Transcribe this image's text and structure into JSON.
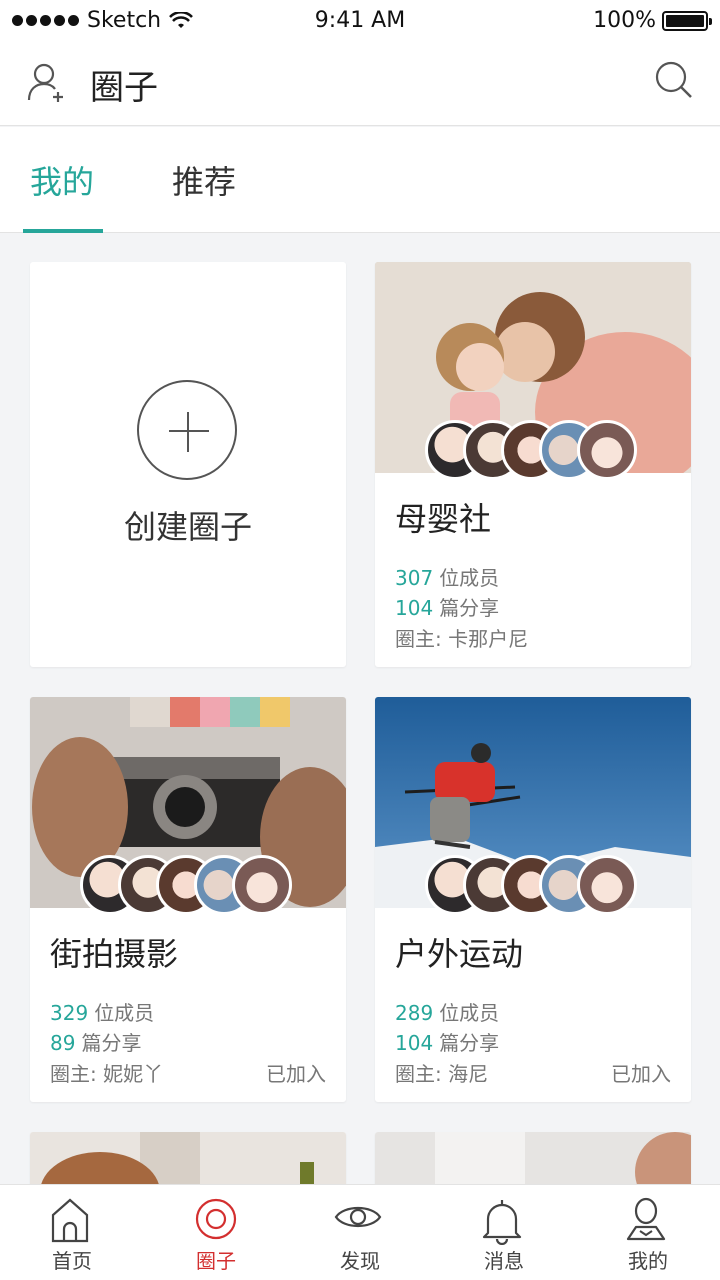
{
  "status_bar": {
    "carrier": "Sketch",
    "time": "9:41 AM",
    "battery": "100%"
  },
  "header": {
    "title": "圈子"
  },
  "tabs": [
    {
      "label": "我的",
      "active": true
    },
    {
      "label": "推荐",
      "active": false
    }
  ],
  "create_card": {
    "label": "创建圈子"
  },
  "circles": [
    {
      "title": "母婴社",
      "members": "307",
      "members_label": "位成员",
      "shares": "104",
      "shares_label": "篇分享",
      "owner": "圈主: 卡那户尼",
      "joined": ""
    },
    {
      "title": "街拍摄影",
      "members": "329",
      "members_label": "位成员",
      "shares": "89",
      "shares_label": "篇分享",
      "owner": "圈主: 妮妮丫",
      "joined": "已加入"
    },
    {
      "title": "户外运动",
      "members": "289",
      "members_label": "位成员",
      "shares": "104",
      "shares_label": "篇分享",
      "owner": "圈主: 海尼",
      "joined": "已加入"
    }
  ],
  "nav": [
    {
      "label": "首页",
      "icon": "home-icon",
      "active": false
    },
    {
      "label": "圈子",
      "icon": "circle-icon",
      "active": true
    },
    {
      "label": "发现",
      "icon": "eye-icon",
      "active": false
    },
    {
      "label": "消息",
      "icon": "bell-icon",
      "active": false
    },
    {
      "label": "我的",
      "icon": "user-icon",
      "active": false
    }
  ],
  "colors": {
    "accent": "#26a69a",
    "nav_active": "#d32f2f"
  }
}
